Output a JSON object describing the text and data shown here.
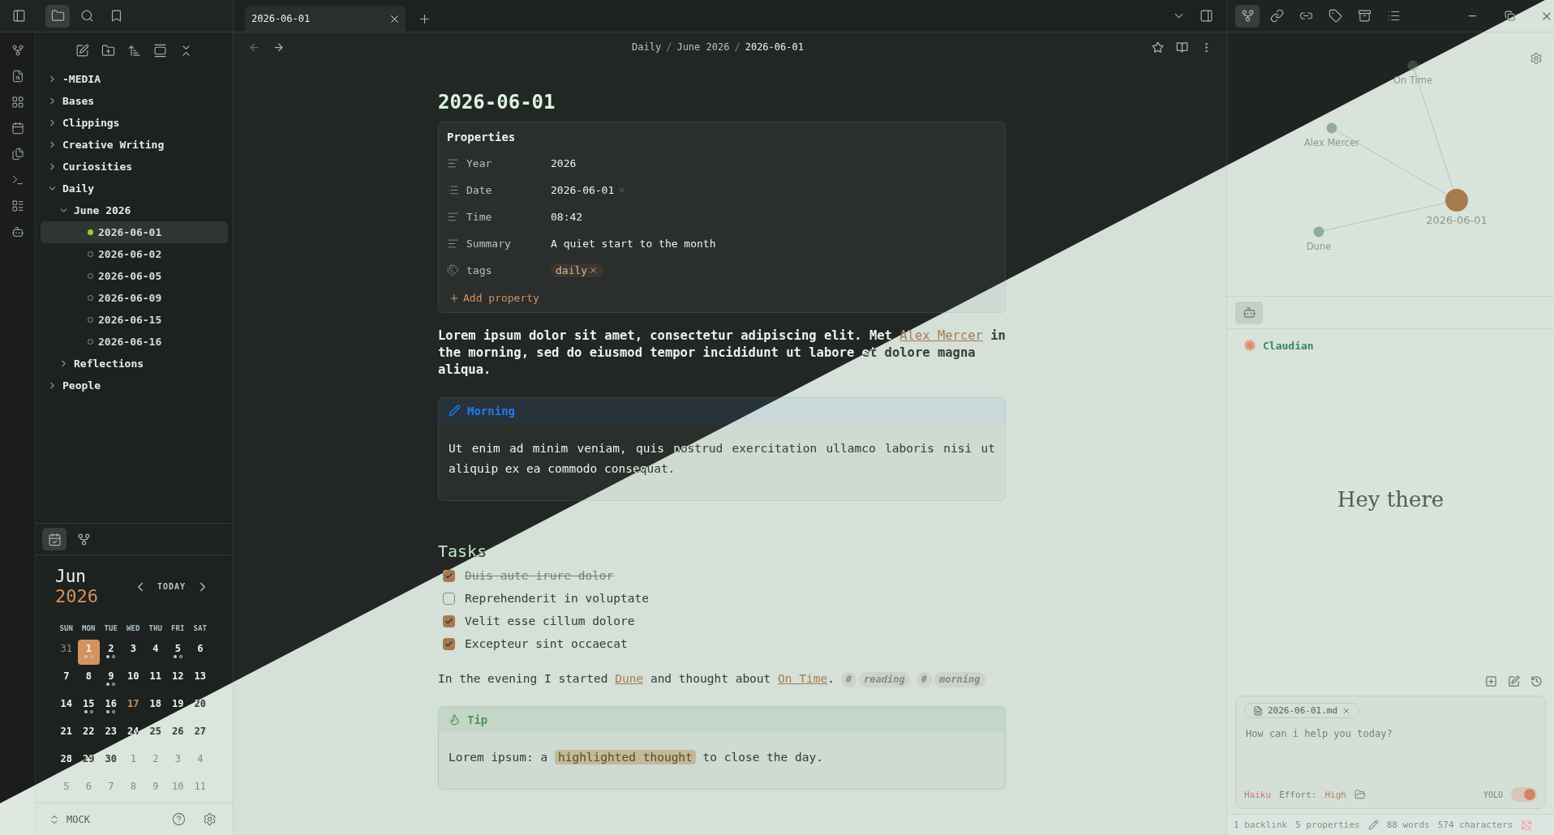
{
  "left_panel_tabs": [
    {
      "selected": true
    },
    {
      "selected": false
    },
    {
      "selected": false
    }
  ],
  "file_tree": [
    {
      "kind": "folder",
      "label": "-MEDIA",
      "expanded": false
    },
    {
      "kind": "folder",
      "label": "Bases",
      "expanded": false
    },
    {
      "kind": "folder",
      "label": "Clippings",
      "expanded": false
    },
    {
      "kind": "folder",
      "label": "Creative Writing",
      "expanded": false
    },
    {
      "kind": "folder",
      "label": "Curiosities",
      "expanded": false
    },
    {
      "kind": "folder",
      "label": "Daily",
      "expanded": true,
      "children": [
        {
          "kind": "folder",
          "label": "June 2026",
          "expanded": true,
          "children": [
            {
              "kind": "file",
              "label": "2026-06-01",
              "selected": true
            },
            {
              "kind": "file",
              "label": "2026-06-02",
              "selected": false
            },
            {
              "kind": "file",
              "label": "2026-06-05",
              "selected": false
            },
            {
              "kind": "file",
              "label": "2026-06-09",
              "selected": false
            },
            {
              "kind": "file",
              "label": "2026-06-15",
              "selected": false
            },
            {
              "kind": "file",
              "label": "2026-06-16",
              "selected": false
            }
          ]
        },
        {
          "kind": "folder",
          "label": "Reflections",
          "expanded": false
        }
      ]
    },
    {
      "kind": "folder",
      "label": "People",
      "expanded": false
    }
  ],
  "calendar_panel_tabs": [
    {
      "selected": true
    },
    {
      "selected": false
    }
  ],
  "calendar": {
    "month": "Jun",
    "year": "2026",
    "today_label": "TODAY",
    "weekdays": [
      "SUN",
      "MON",
      "TUE",
      "WED",
      "THU",
      "FRI",
      "SAT"
    ],
    "days": [
      {
        "label": "31",
        "outside": true,
        "selected": false,
        "today": false,
        "notes": false
      },
      {
        "label": "1",
        "outside": false,
        "selected": true,
        "today": false,
        "notes": true
      },
      {
        "label": "2",
        "outside": false,
        "selected": false,
        "today": false,
        "notes": true
      },
      {
        "label": "3",
        "outside": false,
        "selected": false,
        "today": false,
        "notes": false
      },
      {
        "label": "4",
        "outside": false,
        "selected": false,
        "today": false,
        "notes": false
      },
      {
        "label": "5",
        "outside": false,
        "selected": false,
        "today": false,
        "notes": true
      },
      {
        "label": "6",
        "outside": false,
        "selected": false,
        "today": false,
        "notes": false
      },
      {
        "label": "7",
        "outside": false,
        "selected": false,
        "today": false,
        "notes": false
      },
      {
        "label": "8",
        "outside": false,
        "selected": false,
        "today": false,
        "notes": false
      },
      {
        "label": "9",
        "outside": false,
        "selected": false,
        "today": false,
        "notes": true
      },
      {
        "label": "10",
        "outside": false,
        "selected": false,
        "today": false,
        "notes": false
      },
      {
        "label": "11",
        "outside": false,
        "selected": false,
        "today": false,
        "notes": false
      },
      {
        "label": "12",
        "outside": false,
        "selected": false,
        "today": false,
        "notes": false
      },
      {
        "label": "13",
        "outside": false,
        "selected": false,
        "today": false,
        "notes": false
      },
      {
        "label": "14",
        "outside": false,
        "selected": false,
        "today": false,
        "notes": false
      },
      {
        "label": "15",
        "outside": false,
        "selected": false,
        "today": false,
        "notes": true
      },
      {
        "label": "16",
        "outside": false,
        "selected": false,
        "today": false,
        "notes": true
      },
      {
        "label": "17",
        "outside": false,
        "selected": false,
        "today": true,
        "notes": false
      },
      {
        "label": "18",
        "outside": false,
        "selected": false,
        "today": false,
        "notes": false
      },
      {
        "label": "19",
        "outside": false,
        "selected": false,
        "today": false,
        "notes": false
      },
      {
        "label": "20",
        "outside": false,
        "selected": false,
        "today": false,
        "notes": false
      },
      {
        "label": "21",
        "outside": false,
        "selected": false,
        "today": false,
        "notes": false
      },
      {
        "label": "22",
        "outside": false,
        "selected": false,
        "today": false,
        "notes": false
      },
      {
        "label": "23",
        "outside": false,
        "selected": false,
        "today": false,
        "notes": false
      },
      {
        "label": "24",
        "outside": false,
        "selected": false,
        "today": false,
        "notes": false
      },
      {
        "label": "25",
        "outside": false,
        "selected": false,
        "today": false,
        "notes": false
      },
      {
        "label": "26",
        "outside": false,
        "selected": false,
        "today": false,
        "notes": false
      },
      {
        "label": "27",
        "outside": false,
        "selected": false,
        "today": false,
        "notes": false
      },
      {
        "label": "28",
        "outside": false,
        "selected": false,
        "today": false,
        "notes": false
      },
      {
        "label": "29",
        "outside": false,
        "selected": false,
        "today": false,
        "notes": false
      },
      {
        "label": "30",
        "outside": false,
        "selected": false,
        "today": false,
        "notes": false
      },
      {
        "label": "1",
        "outside": true,
        "selected": false,
        "today": false,
        "notes": false
      },
      {
        "label": "2",
        "outside": true,
        "selected": false,
        "today": false,
        "notes": false
      },
      {
        "label": "3",
        "outside": true,
        "selected": false,
        "today": false,
        "notes": false
      },
      {
        "label": "4",
        "outside": true,
        "selected": false,
        "today": false,
        "notes": false
      },
      {
        "label": "5",
        "outside": true,
        "selected": false,
        "today": false,
        "notes": false
      },
      {
        "label": "6",
        "outside": true,
        "selected": false,
        "today": false,
        "notes": false
      },
      {
        "label": "7",
        "outside": true,
        "selected": false,
        "today": false,
        "notes": false
      },
      {
        "label": "8",
        "outside": true,
        "selected": false,
        "today": false,
        "notes": false
      },
      {
        "label": "9",
        "outside": true,
        "selected": false,
        "today": false,
        "notes": false
      },
      {
        "label": "10",
        "outside": true,
        "selected": false,
        "today": false,
        "notes": false
      },
      {
        "label": "11",
        "outside": true,
        "selected": false,
        "today": false,
        "notes": false
      }
    ]
  },
  "vault": {
    "name": "MOCK"
  },
  "tabs": [
    {
      "label": "2026-06-01",
      "selected": true
    }
  ],
  "breadcrumb": {
    "separator": "/",
    "items": [
      "Daily",
      "June 2026",
      "2026-06-01"
    ]
  },
  "note": {
    "title": "2026-06-01",
    "properties": {
      "title": "Properties",
      "add_label": "Add property",
      "items": [
        {
          "kind": "text",
          "name": "Year",
          "value": "2026"
        },
        {
          "kind": "date",
          "name": "Date",
          "value": "2026-06-01"
        },
        {
          "kind": "text",
          "name": "Time",
          "value": "08:42"
        },
        {
          "kind": "text",
          "name": "Summary",
          "value": "A quiet start to the month"
        },
        {
          "kind": "tags",
          "name": "tags",
          "tags": [
            "daily"
          ]
        }
      ]
    },
    "intro": [
      {
        "kind": "text",
        "text": "Lorem ipsum dolor sit amet, consectetur adipiscing elit. Met "
      },
      {
        "kind": "link",
        "text": "Alex Mercer"
      },
      {
        "kind": "text",
        "text": " in the morning, sed do eiusmod tempor incididunt ut labore et dolore magna aliqua."
      }
    ],
    "morning_callout": {
      "title": "Morning",
      "body": "Ut enim ad minim veniam, quis nostrud exercitation ullamco laboris nisi ut aliquip ex ea commodo consequat."
    },
    "tasks_heading": "Tasks",
    "tasks": [
      {
        "text": "Duis aute irure dolor",
        "checked": true,
        "struck": true
      },
      {
        "text": "Reprehenderit in voluptate",
        "checked": false,
        "struck": false
      },
      {
        "text": "Velit esse cillum dolore",
        "checked": true,
        "struck": false
      },
      {
        "text": "Excepteur sint occaecat",
        "checked": true,
        "struck": false
      }
    ],
    "evening": [
      {
        "kind": "text",
        "text": "In the evening I started "
      },
      {
        "kind": "link",
        "text": "Dune"
      },
      {
        "kind": "text",
        "text": " and thought about "
      },
      {
        "kind": "link",
        "text": "On Time"
      },
      {
        "kind": "text",
        "text": "."
      },
      {
        "kind": "tag",
        "hash": "#",
        "text": "reading"
      },
      {
        "kind": "tag",
        "hash": "#",
        "text": "morning"
      }
    ],
    "tip_callout": {
      "title": "Tip",
      "body": [
        {
          "kind": "text",
          "text": "Lorem ipsum: a "
        },
        {
          "kind": "highlight",
          "text": "highlighted thought"
        },
        {
          "kind": "text",
          "text": " to close the day."
        }
      ]
    }
  },
  "right_panel_tabs": [
    {
      "selected": true
    },
    {
      "selected": false
    },
    {
      "selected": false
    },
    {
      "selected": false
    },
    {
      "selected": false
    },
    {
      "selected": false
    }
  ],
  "graph": {
    "nodes": [
      {
        "label": "On Time",
        "kind": "unresolved"
      },
      {
        "label": "Alex Mercer",
        "kind": "resolved"
      },
      {
        "label": "2026-06-01",
        "kind": "current"
      },
      {
        "label": "Dune",
        "kind": "resolved"
      }
    ]
  },
  "chat_panel_tabs": [
    {
      "selected": true
    }
  ],
  "chat": {
    "title": "Claudian",
    "greeting": "Hey there",
    "attachment": "2026-06-01.md",
    "placeholder": "How can i help you today?",
    "model": "Haiku",
    "effort_label": "Effort:",
    "effort": "High",
    "yolo_label": "YOLO",
    "yolo_on": true
  },
  "status_bar": [
    "1 backlink",
    "5 properties",
    "88 words",
    "574 characters"
  ]
}
